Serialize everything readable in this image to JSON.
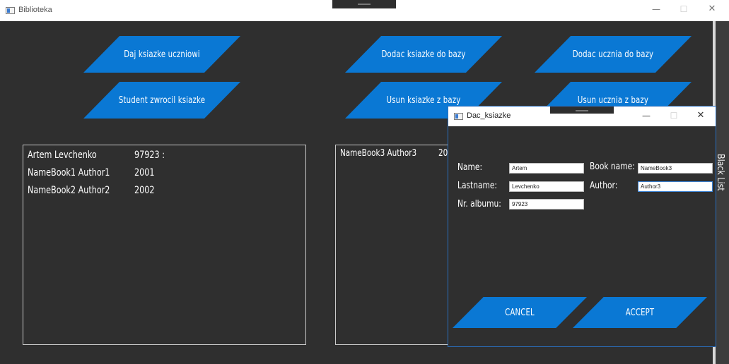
{
  "window": {
    "title": "Biblioteka",
    "minimize": "—",
    "maximize": "☐",
    "close": "✕"
  },
  "buttons": {
    "give_book": "Daj ksiazke uczniowi",
    "student_returned": "Student zwrocil ksiazke",
    "add_book": "Dodac ksiazke do bazy",
    "remove_book": "Usun ksiazke z bazy",
    "add_student": "Dodac ucznia do bazy",
    "remove_student": "Usun ucznia z bazy"
  },
  "student_list": {
    "rows": [
      {
        "col1": "Artem Levchenko",
        "col2": "97923 :"
      },
      {
        "col1": "NameBook1  Author1",
        "col2": "2001"
      },
      {
        "col1": "NameBook2  Author2",
        "col2": "2002"
      }
    ]
  },
  "book_list": {
    "rows": [
      {
        "col1": "NameBook3  Author3",
        "col2": "20"
      }
    ]
  },
  "side_tab": "Black List",
  "dialog": {
    "title": "Dac_ksiazke",
    "minimize": "—",
    "maximize": "☐",
    "close": "✕",
    "labels": {
      "name": "Name:",
      "lastname": "Lastname:",
      "album": "Nr. albumu:",
      "book_name": "Book name:",
      "author": "Author:"
    },
    "values": {
      "name": "Artem",
      "lastname": "Levchenko",
      "album": "97923",
      "book_name": "NameBook3",
      "author": "Author3"
    },
    "cancel": "CANCEL",
    "accept": "ACCEPT"
  },
  "colors": {
    "accent": "#0a78d4",
    "background": "#2f2f2f",
    "titlebar": "#ffffff"
  }
}
